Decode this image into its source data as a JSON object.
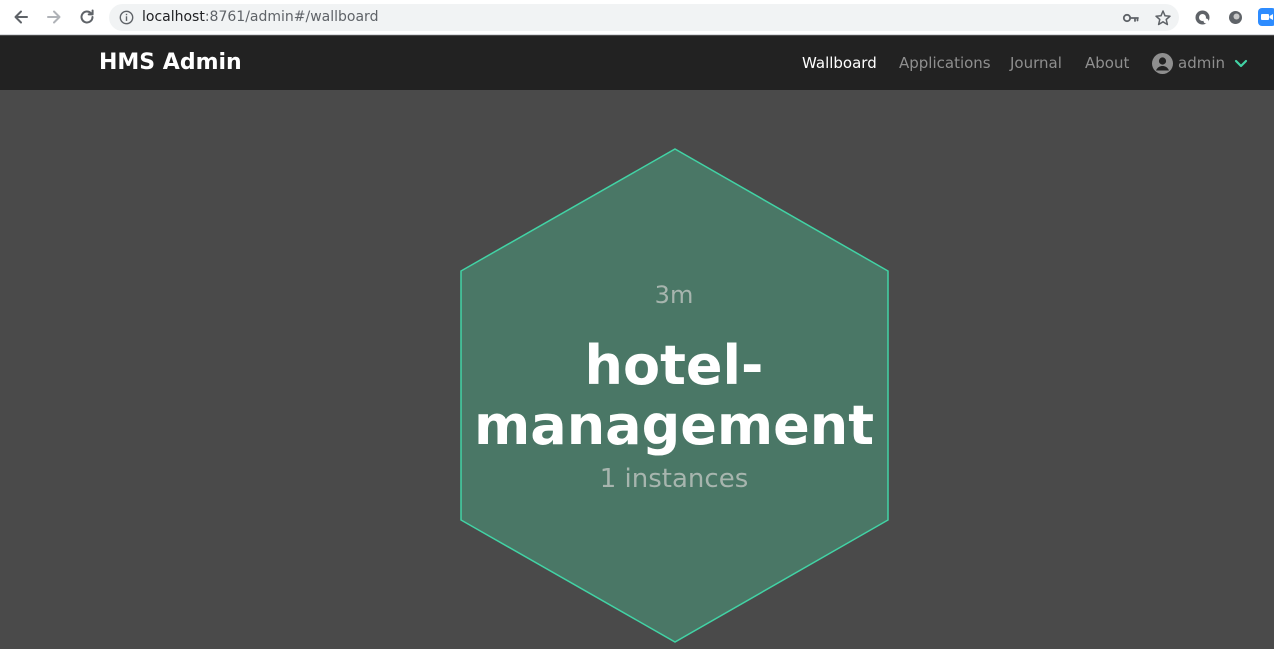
{
  "browser": {
    "url_host": "localhost",
    "url_rest": ":8761/admin#/wallboard",
    "icons": {
      "back": "arrow-left-icon",
      "forward": "arrow-right-icon",
      "reload": "reload-icon",
      "info": "info-icon",
      "key": "key-icon",
      "bookmark": "star-icon"
    }
  },
  "navbar": {
    "brand": "HMS Admin",
    "items": [
      {
        "label": "Wallboard",
        "active": true
      },
      {
        "label": "Applications",
        "active": false
      },
      {
        "label": "Journal",
        "active": false
      },
      {
        "label": "About",
        "active": false
      }
    ],
    "user": {
      "name": "admin"
    }
  },
  "wallboard": {
    "applications": [
      {
        "time": "3m",
        "name_line1": "hotel-",
        "name_line2": "management",
        "instances": "1 instances",
        "status_color": "#42d3a5"
      }
    ]
  },
  "colors": {
    "navbar_bg": "#222222",
    "page_bg": "#4a4a4a",
    "hex_fill": "#4a7766",
    "hex_stroke": "#42d3a5",
    "accent": "#42d3a5"
  }
}
